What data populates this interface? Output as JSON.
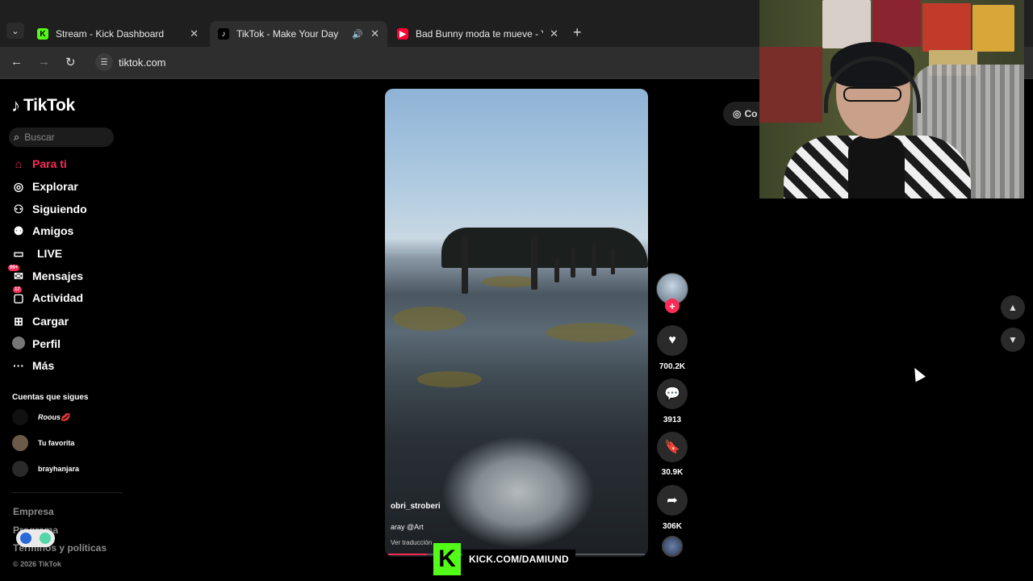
{
  "browser": {
    "tabs": [
      {
        "title": "Stream - Kick Dashboard",
        "favicon": "kick-icon",
        "active": false
      },
      {
        "title": "TikTok - Make Your Day",
        "favicon": "tiktok-icon",
        "active": true,
        "audio": true
      },
      {
        "title": "Bad Bunny moda te mueve - Yo",
        "favicon": "youtube-icon",
        "active": false
      }
    ],
    "url": "tiktok.com"
  },
  "tiktok": {
    "logo_text": "TikTok",
    "search_placeholder": "Buscar",
    "nav": [
      {
        "label": "Para ti",
        "icon": "home-icon",
        "active": true
      },
      {
        "label": "Explorar",
        "icon": "compass-icon"
      },
      {
        "label": "Siguiendo",
        "icon": "user-follow-icon"
      },
      {
        "label": "Amigos",
        "icon": "friends-icon"
      },
      {
        "label": "LIVE",
        "icon": "live-tv-icon"
      },
      {
        "label": "Mensajes",
        "icon": "message-icon",
        "badge": "99+"
      },
      {
        "label": "Actividad",
        "icon": "activity-icon",
        "badge": "17"
      },
      {
        "label": "Cargar",
        "icon": "upload-icon"
      },
      {
        "label": "Perfil",
        "icon": "profile-avatar"
      },
      {
        "label": "Más",
        "icon": "more-icon"
      }
    ],
    "following_header": "Cuentas que sigues",
    "following": [
      {
        "name": "Roous💋"
      },
      {
        "name": "Tu favorita"
      },
      {
        "name": "brayhanjara"
      }
    ],
    "footer": {
      "company": "Empresa",
      "program": "Programa",
      "terms": "Términos y políticas",
      "copyright": "© 2026 TikTok"
    },
    "coins_label": "Co",
    "video": {
      "author": "obri_stroberi",
      "caption": "aray @Art",
      "translate": "Ver traducción",
      "progress": 0.15
    },
    "actions": {
      "likes": "700.2K",
      "comments": "3913",
      "saves": "30.9K",
      "shares": "306K"
    }
  },
  "overlay": {
    "kick_text": "KICK.COM/DAMIUND",
    "kick_color": "#53fc18"
  },
  "colors": {
    "tiktok_accent": "#fe2c55"
  }
}
